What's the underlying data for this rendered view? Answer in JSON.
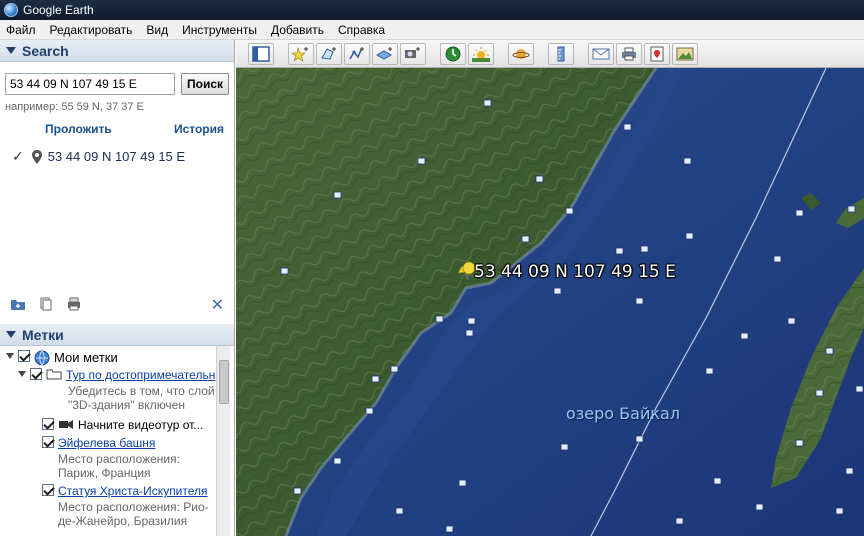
{
  "app": {
    "title": "Google Earth"
  },
  "menu": [
    "Файл",
    "Редактировать",
    "Вид",
    "Инструменты",
    "Добавить",
    "Справка"
  ],
  "search": {
    "header": "Search",
    "input_value": "53 44 09 N 107 49 15 E",
    "button_label": "Поиск",
    "example": "например: 55 59 N, 37 37 E",
    "route_link": "Проложить маршрут",
    "history_link": "История",
    "result": "53 44 09 N 107 49 15 E"
  },
  "places": {
    "header": "Метки",
    "my_places": "Мои метки",
    "tour": "Тур по достопримечательн",
    "tour_note_1": "Убедитесь в том, что слой",
    "tour_note_2": "\"3D-здания\" включен",
    "video_tour": "Начните видеотур от...",
    "eiffel": "Эйфелева башня",
    "eiffel_loc_1": "Место расположения:",
    "eiffel_loc_2": "Париж, Франция",
    "christ": "Статуя Христа-Искупителя",
    "christ_loc_1": "Место расположения: Рио-",
    "christ_loc_2": "де-Жанейро, Бразилия"
  },
  "map": {
    "placemark_label": "53 44 09 N 107 49 15 E",
    "lake_label": "озеро Байкал"
  },
  "icons": {
    "toolbar": [
      "sidebar-toggle-icon",
      "add-placemark-icon",
      "add-polygon-icon",
      "add-path-icon",
      "add-overlay-icon",
      "record-tour-icon",
      "historical-imagery-icon",
      "sunlight-icon",
      "planets-icon",
      "ruler-icon",
      "email-icon",
      "print-icon",
      "view-in-maps-icon",
      "save-image-icon"
    ]
  },
  "colors": {
    "water": "#1f3d7f",
    "land": "#3a5a2e",
    "link": "#0b3fa8",
    "header_text": "#1f3f6e"
  }
}
